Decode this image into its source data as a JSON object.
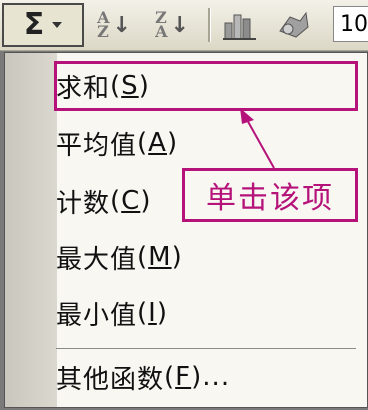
{
  "toolbar": {
    "autosum_symbol": "Σ",
    "sort_asc": {
      "top": "A",
      "bottom": "Z"
    },
    "sort_desc": {
      "top": "Z",
      "bottom": "A"
    },
    "zoom_value": "10"
  },
  "menu": {
    "items": [
      {
        "label": "求和",
        "accelerator": "S"
      },
      {
        "label": "平均值",
        "accelerator": "A"
      },
      {
        "label": "计数",
        "accelerator": "C"
      },
      {
        "label": "最大值",
        "accelerator": "M"
      },
      {
        "label": "最小值",
        "accelerator": "I"
      }
    ],
    "more": {
      "label": "其他函数",
      "accelerator": "F",
      "suffix": "..."
    }
  },
  "annotation": {
    "text": "单击该项"
  },
  "colors": {
    "highlight": "#b5137a"
  },
  "icons": [
    "autosum-icon",
    "dropdown-arrow-icon",
    "sort-ascending-icon",
    "sort-descending-icon",
    "chart-wizard-icon",
    "drawing-icon"
  ]
}
